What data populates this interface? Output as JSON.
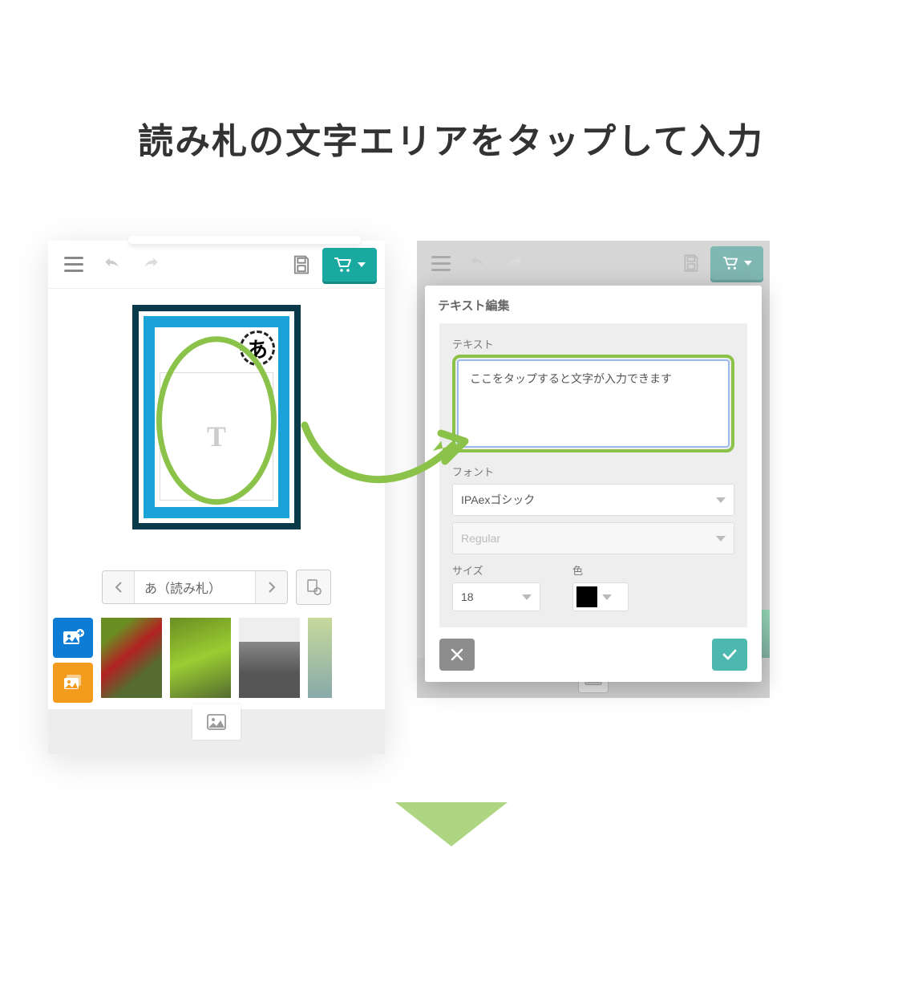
{
  "heading": "読み札の文字エリアをタップして入力",
  "left": {
    "card_badge": "あ",
    "text_placeholder_glyph": "T",
    "page_label": "あ（読み札）"
  },
  "right": {
    "modal_title": "テキスト編集",
    "text_label": "テキスト",
    "text_value": "ここをタップすると文字が入力できます",
    "font_label": "フォント",
    "font_value": "IPAexゴシック",
    "weight_value": "Regular",
    "size_label": "サイズ",
    "size_value": "18",
    "color_label": "色",
    "color_value": "#000000"
  }
}
